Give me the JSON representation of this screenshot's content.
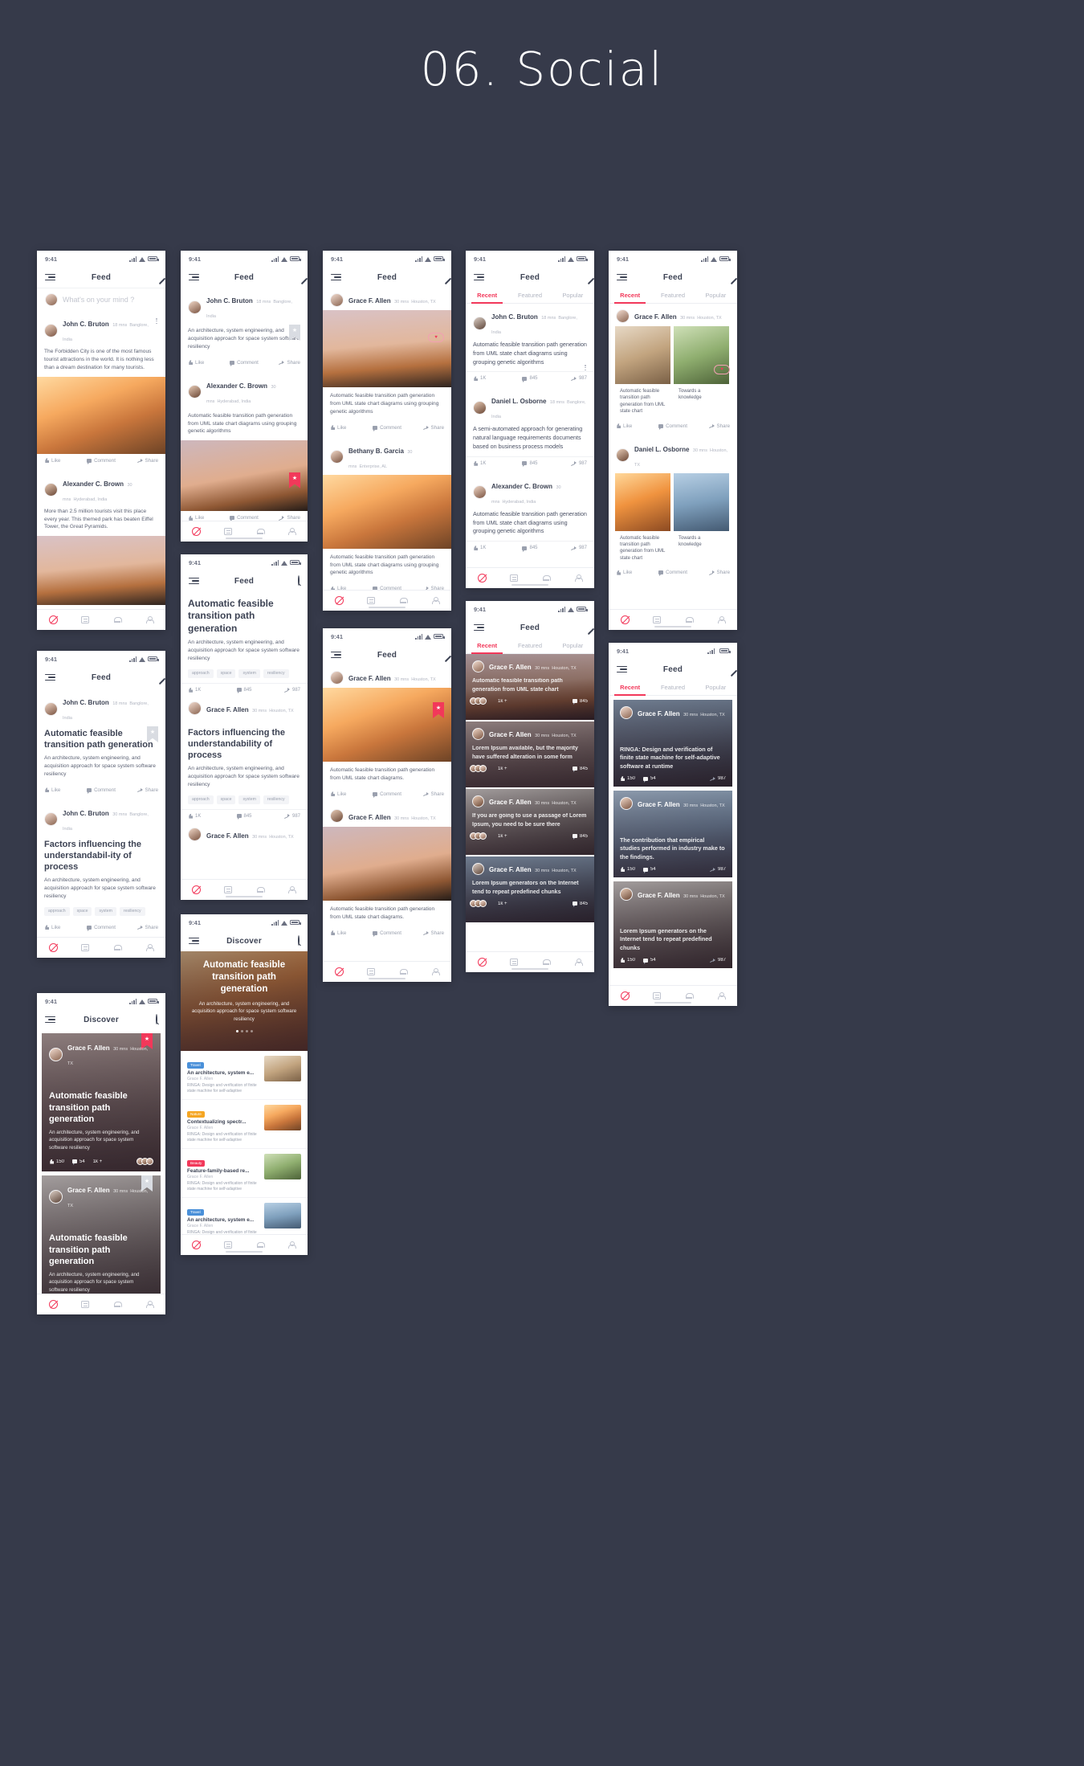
{
  "page": {
    "title": "06. Social"
  },
  "common": {
    "status_time": "9:41",
    "nav_feed": "Feed",
    "nav_discover": "Discover",
    "composer_placeholder": "What's on your mind ?",
    "actions": {
      "like": "Like",
      "comment": "Comment",
      "share": "Share"
    },
    "tabs": {
      "recent": "Recent",
      "featured": "Featured",
      "popular": "Popular"
    },
    "stats": {
      "views": "1K",
      "comments": "845",
      "shares": "987",
      "likes": "150",
      "cmt2": "54",
      "plus": "1k +"
    },
    "tags": [
      "approach",
      "space",
      "system",
      "resiliency"
    ],
    "icons": {
      "menu": "hamburger-icon",
      "edit": "pencil-icon",
      "search": "search-icon",
      "bookmark": "bookmark-star-icon",
      "more": "more-vertical-icon",
      "home": "home-icon",
      "feed": "feed-icon",
      "bell": "bell-icon",
      "profile": "profile-icon"
    },
    "accent": "#f2385a",
    "bg": "#363a4a"
  },
  "users": {
    "john": {
      "name": "John C. Bruton",
      "time": "18 mns",
      "place": "Banglore, India"
    },
    "alex": {
      "name": "Alexander C. Brown",
      "time": "30 mns",
      "place": "Hyderabad, India"
    },
    "grace": {
      "name": "Grace F. Allen",
      "time": "30 mns",
      "place": "Houston, TX"
    },
    "beth": {
      "name": "Bethany B. Garcia",
      "time": "30 mns",
      "place": "Enterprise, AL"
    },
    "daniel": {
      "name": "Daniel L. Osborne",
      "time": "18 mns",
      "place": "Banglore, India"
    }
  },
  "texts": {
    "forbidden": "The Forbidden City is one of the most famous tourist attractions in the world. It is nothing less than a dream destination for many tourists.",
    "tourists": "More than 2.5 million tourists visit this place every year. This themed park has beaten Eiffel Tower, the Great Pyramids.",
    "architecture": "An architecture, system engineering, and acquisition approach for space system software resiliency",
    "automatic_long": "Automatic feasible transition path generation from UML state chart diagrams using grouping genetic algorithms",
    "automatic_short": "Automatic feasible transition path generation from UML state chart diagrams.",
    "automatic_uml": "Automatic feasible transition path generation from UML state chart",
    "semi_auto": "A semi-automated approach for generating natural language requirements documents based on business process models",
    "headline_auto": "Automatic feasible transition path generation",
    "headline_factors": "Factors influencing the understandabil-ity of process",
    "headline_factors2": "Factors influencing the understandability of process",
    "ringa": "RINGA: Design and verification of finite state machine for self-adaptive software at runtime",
    "ringa_short": "RINGA: Design and verification of finite state machine for self-adaptive",
    "contribution": "The contribution that empirical studies performed in industry make to the findings.",
    "lorem_avail": "Lorem Ipsum available, but the majority have suffered alteration in some form",
    "lorem_passage": "If you are going to use a passage of Lorem Ipsum, you need to be sure there",
    "lorem_gen": "Lorem Ipsum generators on the Internet tend to repeat predefined chunks",
    "towards_know": "Towards a knowledge"
  },
  "discover_list": [
    {
      "badge": "Travel",
      "title": "An architecture, system e...",
      "author": "Grace F. Allen",
      "desc": "RINGA: Design and verification of finite state machine for self-adaptive"
    },
    {
      "badge": "Nature",
      "title": "Contextualizing spectr...",
      "author": "Grace F. Allen",
      "desc": "RINGA: Design and verification of finite state machine for self-adaptive"
    },
    {
      "badge": "Beauty",
      "title": "Feature-family-based re...",
      "author": "Grace F. Allen",
      "desc": "RINGA: Design and verification of finite state machine for self-adaptive"
    },
    {
      "badge": "Travel",
      "title": "An architecture, system e...",
      "author": "Grace F. Allen",
      "desc": "RINGA: Design and verification of finite state machine for self-adaptive"
    }
  ]
}
